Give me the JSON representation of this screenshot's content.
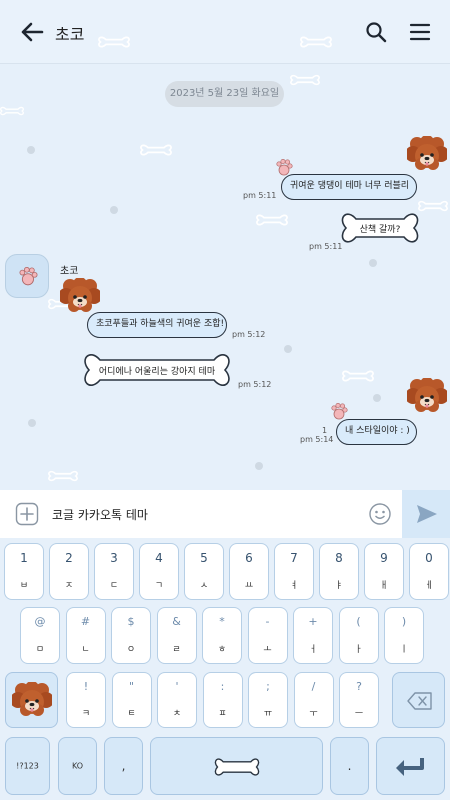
{
  "header": {
    "title": "초코"
  },
  "chat": {
    "date": "2023년 5월 23일 화요일",
    "sender_name": "초코",
    "messages": [
      {
        "side": "right",
        "text": "귀여운 댕댕이 테마 너무 러블리",
        "time": "pm 5:11"
      },
      {
        "side": "right",
        "text": "산책 갈까?",
        "time": "pm 5:11"
      },
      {
        "side": "left",
        "text": "초코푸들과 하늘색의 귀여운 조합!",
        "time": "pm 5:12"
      },
      {
        "side": "left",
        "text": "어디에나 어울리는 강아지 테마",
        "time": "pm 5:12"
      },
      {
        "side": "right",
        "text": "내 스타일이야 : )",
        "time": "pm 5:14",
        "unread": "1"
      }
    ]
  },
  "input": {
    "value": "코글 카카오톡 테마"
  },
  "keyboard": {
    "number_row": [
      {
        "top": "1",
        "bottom": "ㅂ"
      },
      {
        "top": "2",
        "bottom": "ㅈ"
      },
      {
        "top": "3",
        "bottom": "ㄷ"
      },
      {
        "top": "4",
        "bottom": "ㄱ"
      },
      {
        "top": "5",
        "bottom": "ㅅ"
      },
      {
        "top": "6",
        "bottom": "ㅛ"
      },
      {
        "top": "7",
        "bottom": "ㅕ"
      },
      {
        "top": "8",
        "bottom": "ㅑ"
      },
      {
        "top": "9",
        "bottom": "ㅐ"
      },
      {
        "top": "0",
        "bottom": "ㅔ"
      }
    ],
    "middle_row": [
      {
        "top": "@",
        "bottom": "ㅁ"
      },
      {
        "top": "#",
        "bottom": "ㄴ"
      },
      {
        "top": "$",
        "bottom": "ㅇ"
      },
      {
        "top": "&",
        "bottom": "ㄹ"
      },
      {
        "top": "*",
        "bottom": "ㅎ"
      },
      {
        "top": "-",
        "bottom": "ㅗ"
      },
      {
        "top": "+",
        "bottom": "ㅓ"
      },
      {
        "top": "(",
        "bottom": "ㅏ"
      },
      {
        "top": ")",
        "bottom": "ㅣ"
      }
    ],
    "lower_row": [
      {
        "top": "!",
        "bottom": "ㅋ"
      },
      {
        "top": "\"",
        "bottom": "ㅌ"
      },
      {
        "top": "'",
        "bottom": "ㅊ"
      },
      {
        "top": ":",
        "bottom": "ㅍ"
      },
      {
        "top": ";",
        "bottom": "ㅠ"
      },
      {
        "top": "/",
        "bottom": "ㅜ"
      },
      {
        "top": "?",
        "bottom": "ㅡ"
      }
    ],
    "mode_key": "!?123",
    "lang_key": "KO",
    "comma_key": ",",
    "period_key": "."
  },
  "colors": {
    "accent": "#d6e8f8",
    "background": "#e6f0fa",
    "bubble": "#d9ebfb",
    "outline": "#2a3440"
  },
  "icons": [
    "back-arrow-icon",
    "search-icon",
    "menu-icon",
    "plus-icon",
    "emoji-icon",
    "send-icon",
    "backspace-icon",
    "enter-icon",
    "paw-icon",
    "poodle-icon",
    "bone-icon"
  ]
}
